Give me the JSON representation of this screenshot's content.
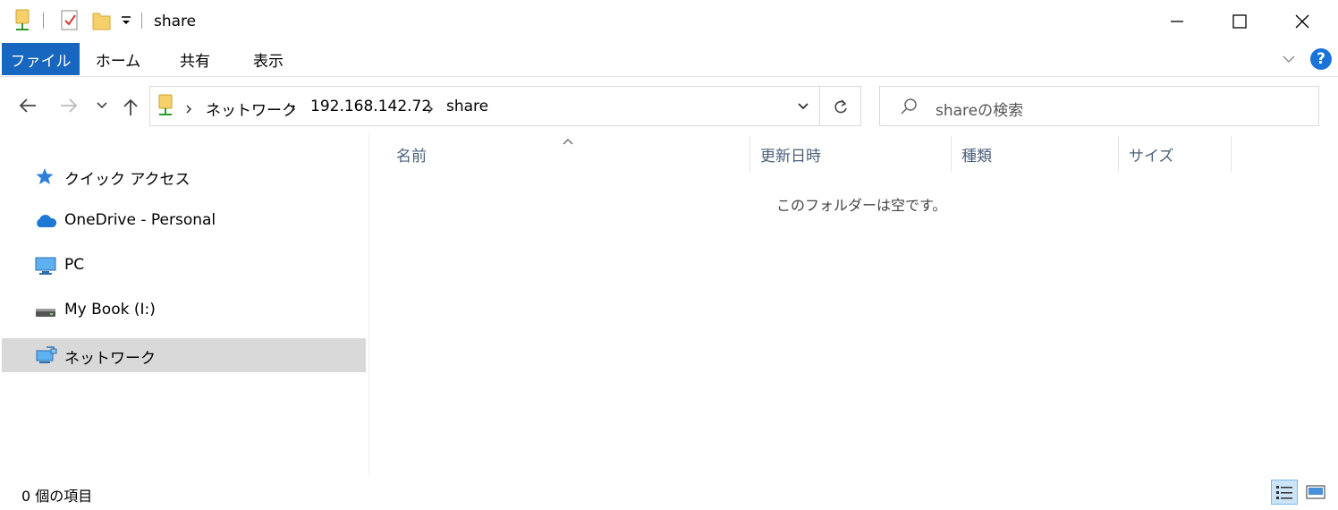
{
  "title_bar": {
    "title": "share",
    "quick_access": [
      "network-drive-icon",
      "properties-check-icon",
      "new-folder-icon",
      "customize-dropdown-icon"
    ],
    "controls": [
      "minimize-icon",
      "maximize-icon",
      "close-icon"
    ]
  },
  "ribbon": {
    "tabs": [
      {
        "label": "ファイル",
        "active": true
      },
      {
        "label": "ホーム"
      },
      {
        "label": "共有"
      },
      {
        "label": "表示"
      }
    ],
    "help_label": "?"
  },
  "navigation": {
    "address": {
      "segments": [
        "ネットワーク",
        "192.168.142.72",
        "share"
      ]
    },
    "search": {
      "placeholder": "shareの検索"
    }
  },
  "sidebar": {
    "items": [
      {
        "label": "クイック アクセス",
        "icon": "star-icon"
      },
      {
        "label": "OneDrive - Personal",
        "icon": "cloud-icon"
      },
      {
        "label": "PC",
        "icon": "monitor-icon"
      },
      {
        "label": "My Book (I:)",
        "icon": "drive-icon"
      },
      {
        "label": "ネットワーク",
        "icon": "network-icon",
        "selected": true
      }
    ]
  },
  "content": {
    "columns": [
      "名前",
      "更新日時",
      "種類",
      "サイズ"
    ],
    "empty_message": "このフォルダーは空です。"
  },
  "status": {
    "item_count": "0 個の項目",
    "views": [
      "details-view-icon",
      "large-icons-view-icon"
    ]
  },
  "colors": {
    "file_tab": "#1766bf",
    "selection": "#d9d9d9",
    "header_text": "#4c607a",
    "help": "#1a73d9"
  }
}
